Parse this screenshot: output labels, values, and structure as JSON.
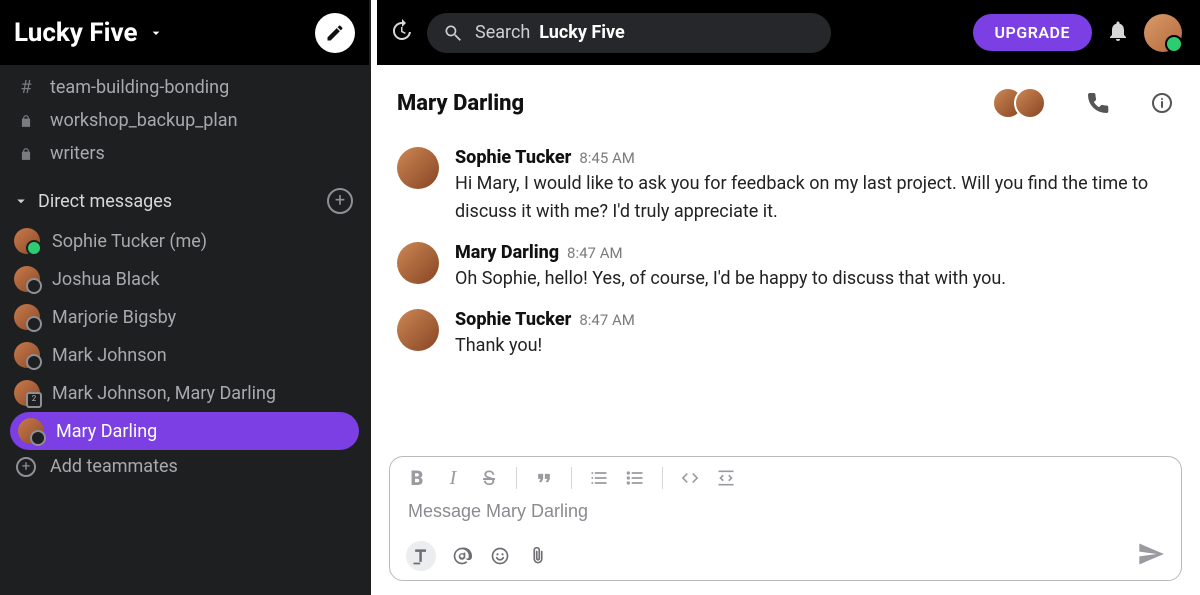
{
  "workspace": {
    "name": "Lucky Five"
  },
  "sidebar": {
    "channels": [
      {
        "name": "team-building-bonding",
        "private": false
      },
      {
        "name": "workshop_backup_plan",
        "private": true
      },
      {
        "name": "writers",
        "private": true
      }
    ],
    "dm_section_label": "Direct messages",
    "dms": [
      {
        "name": "Sophie Tucker (me)",
        "status": "online"
      },
      {
        "name": "Joshua Black",
        "status": "offline"
      },
      {
        "name": "Marjorie Bigsby",
        "status": "offline"
      },
      {
        "name": "Mark Johnson",
        "status": "offline"
      },
      {
        "name": "Mark Johnson, Mary Darling",
        "status": "group"
      },
      {
        "name": "Mary Darling",
        "status": "offline",
        "active": true
      }
    ],
    "add_teammates_label": "Add teammates"
  },
  "topbar": {
    "search_prefix": "Search",
    "search_scope": "Lucky Five",
    "upgrade_label": "UPGRADE"
  },
  "chat": {
    "title": "Mary Darling",
    "messages": [
      {
        "sender": "Sophie Tucker",
        "time": "8:45 AM",
        "text": "Hi Mary, I would like to ask you for feedback on my last project. Will you find the time to discuss it with me? I'd truly appreciate it."
      },
      {
        "sender": "Mary Darling",
        "time": "8:47 AM",
        "text": "Oh Sophie, hello! Yes, of course, I'd be happy to discuss that with you."
      },
      {
        "sender": "Sophie Tucker",
        "time": "8:47 AM",
        "text": "Thank you!"
      }
    ],
    "composer_placeholder": "Message Mary Darling"
  }
}
